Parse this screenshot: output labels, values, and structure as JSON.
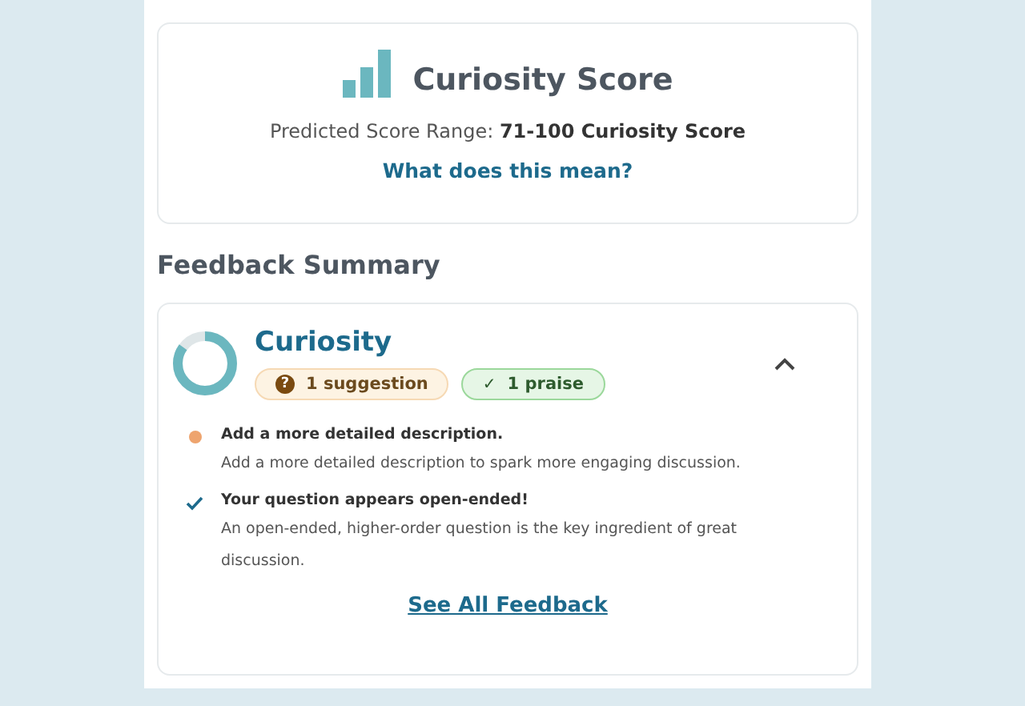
{
  "score_card": {
    "title": "Curiosity Score",
    "range_text": "Predicted Score Range: **71-100 Curiosity Score**",
    "link": "What does this mean?"
  },
  "section_title": "Feedback Summary",
  "feedback": {
    "title": "Curiosity",
    "level": 0.85,
    "expanded": true,
    "badges": [
      {
        "kind": "suggestion",
        "icon": "?",
        "label": "1 suggestion"
      },
      {
        "kind": "praise",
        "icon": "✓",
        "label": "1 praise"
      }
    ],
    "items": [
      {
        "kind": "suggestion",
        "title": "Add a more detailed description.",
        "description": "Add a more detailed description to spark more engaging discussion."
      },
      {
        "kind": "praise",
        "title": "Your question appears open-ended!",
        "description": "An open-ended, higher-order question is the key ingredient of great discussion."
      }
    ],
    "link": "See All Feedback"
  }
}
